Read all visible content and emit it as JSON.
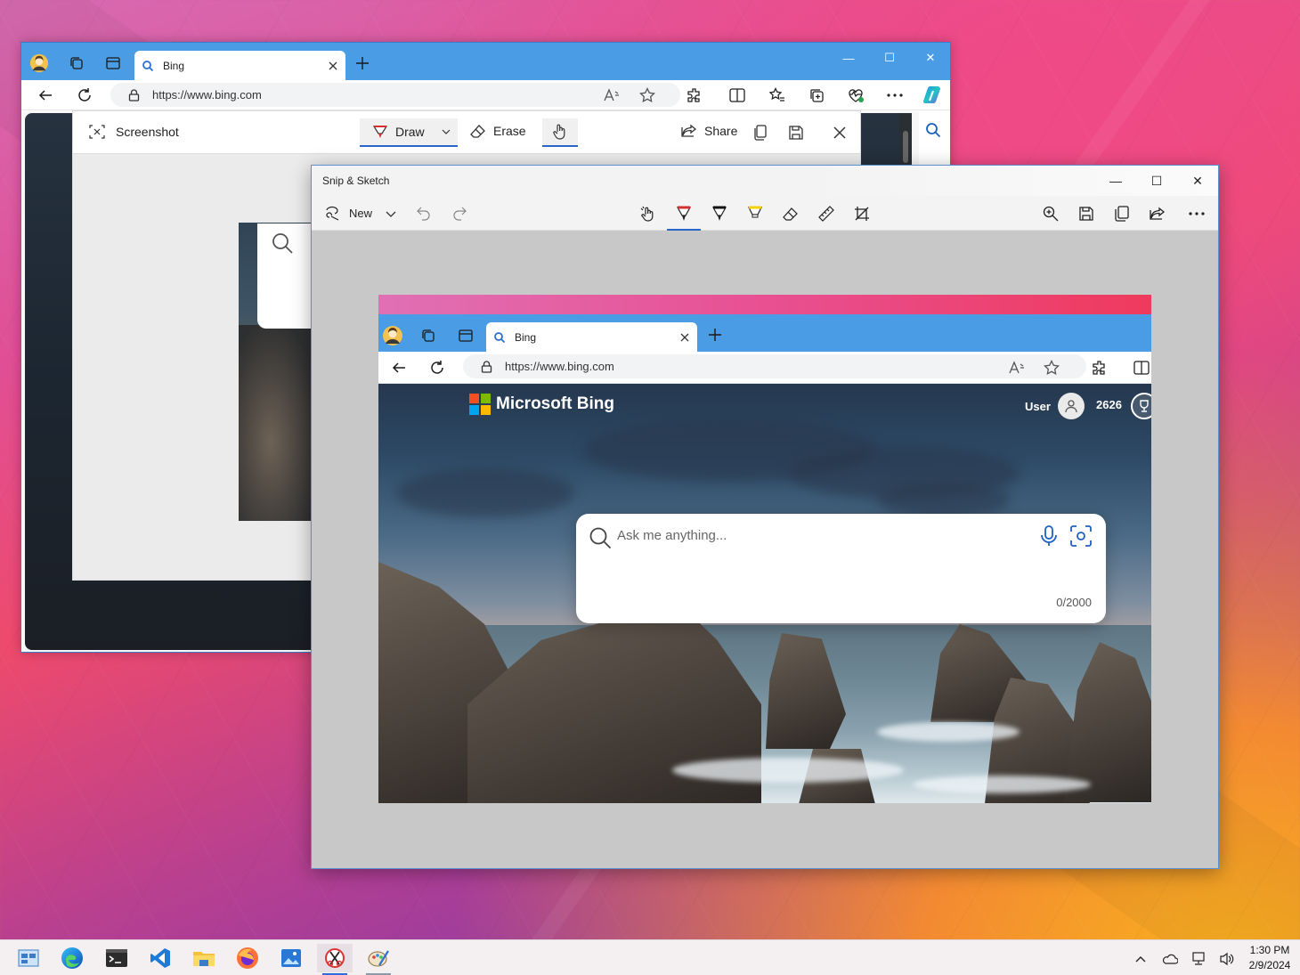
{
  "edge_window": {
    "tab_title": "Bing",
    "url": "https://www.bing.com",
    "win_min": "—",
    "win_max": "☐",
    "win_close": "✕"
  },
  "screenshot_tool": {
    "title": "Screenshot",
    "draw_label": "Draw",
    "erase_label": "Erase",
    "share_label": "Share"
  },
  "snip_window": {
    "title": "Snip & Sketch",
    "new_label": "New",
    "win_min": "—",
    "win_max": "☐",
    "win_close": "✕"
  },
  "captured": {
    "tab_title": "Bing",
    "url": "https://www.bing.com",
    "brand": "Microsoft Bing",
    "user_label": "User",
    "rewards_points": "2626",
    "search_placeholder": "Ask me anything...",
    "char_count": "0/2000"
  },
  "taskbar": {
    "apps": [
      "start-icon",
      "edge-icon",
      "terminal-icon",
      "vscode-icon",
      "file-explorer-icon",
      "firefox-icon",
      "photos-icon",
      "snip-sketch-icon",
      "paint-icon"
    ],
    "time": "1:30 PM",
    "date": "2/9/2024"
  },
  "colors": {
    "edge_accent": "#4a9de4",
    "active_underline": "#2767c7"
  }
}
